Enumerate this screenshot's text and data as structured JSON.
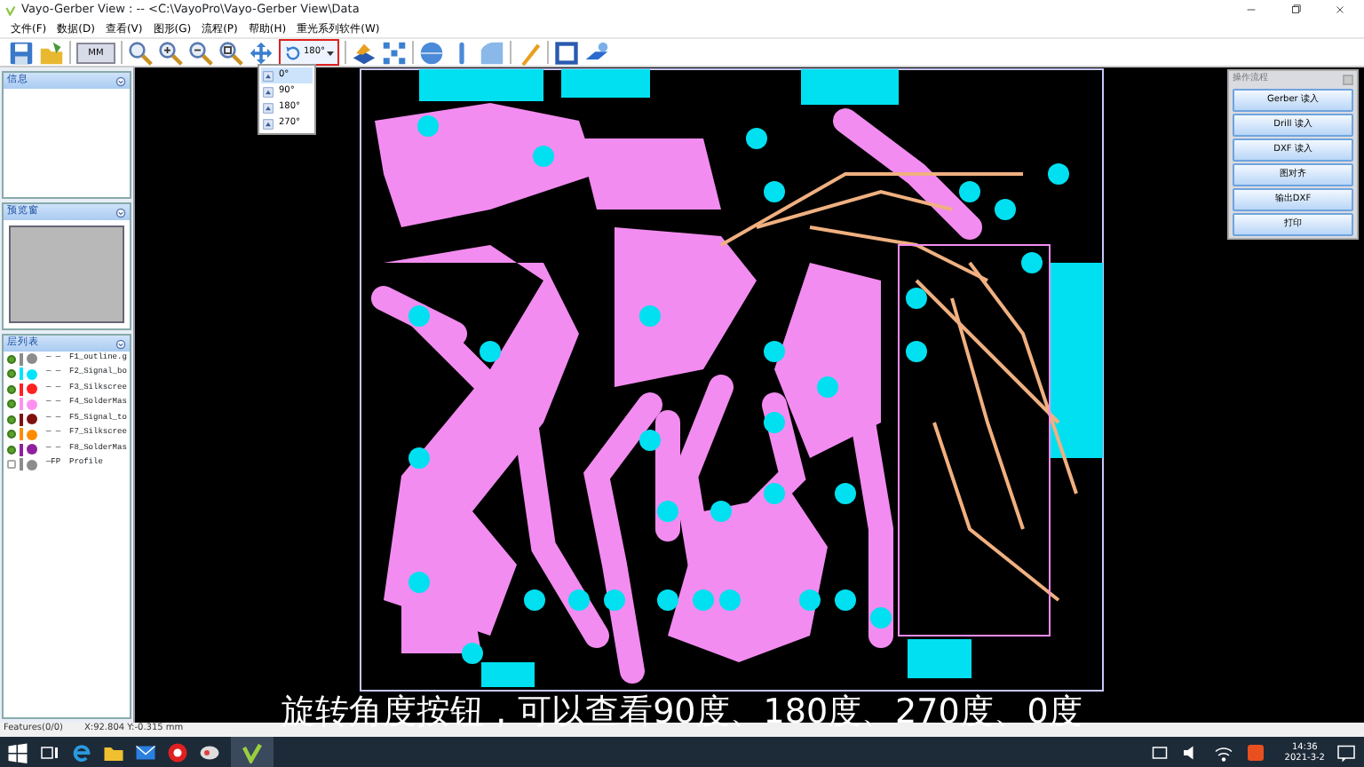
{
  "window": {
    "title": "Vayo-Gerber View : -- <C:\\VayoPro\\Vayo-Gerber View\\Data"
  },
  "menu": [
    "文件(F)",
    "数据(D)",
    "查看(V)",
    "图形(G)",
    "流程(P)",
    "帮助(H)",
    "重光系列软件(W)"
  ],
  "toolbar": {
    "unit": "MM",
    "rotation": "180°"
  },
  "rotation_menu": [
    {
      "label": "0°",
      "selected": true
    },
    {
      "label": "90°",
      "selected": false
    },
    {
      "label": "180°",
      "selected": false
    },
    {
      "label": "270°",
      "selected": false
    }
  ],
  "info_panel": {
    "title": "信息"
  },
  "preview_panel": {
    "title": "预览窗"
  },
  "layer_panel": {
    "title": "层列表",
    "layers": [
      {
        "name": "F1_outline.g",
        "line": "— —",
        "checked": true,
        "color": "#8c8c8c"
      },
      {
        "name": "F2_Signal_bo",
        "line": "— —",
        "checked": true,
        "color": "#00e5ff"
      },
      {
        "name": "F3_Silkscree",
        "line": "— —",
        "checked": true,
        "color": "#ff2020"
      },
      {
        "name": "F4_SolderMas",
        "line": "— —",
        "checked": true,
        "color": "#ff90f0"
      },
      {
        "name": "F5_Signal_to",
        "line": "— —",
        "checked": true,
        "color": "#801010"
      },
      {
        "name": "F7_Silkscree",
        "line": "— —",
        "checked": true,
        "color": "#ff8c00"
      },
      {
        "name": "F8_SolderMas",
        "line": "— —",
        "checked": true,
        "color": "#9020a0"
      },
      {
        "name": "Profile",
        "line": "—FP",
        "checked": false,
        "color": "#8c8c8c"
      }
    ]
  },
  "process_panel": {
    "title": "操作流程",
    "buttons": [
      "Gerber 读入",
      "Drill 读入",
      "DXF 读入",
      "图对齐",
      "输出DXF",
      "打印"
    ]
  },
  "caption": "旋转角度按钮，可以查看90度、180度、270度、0度",
  "status_bar": {
    "features": "Features(0/0)",
    "coordinates": "X:92.804 Y:-0.315 mm"
  },
  "taskbar": {
    "time": "14:36",
    "date": "2021-3-2"
  }
}
